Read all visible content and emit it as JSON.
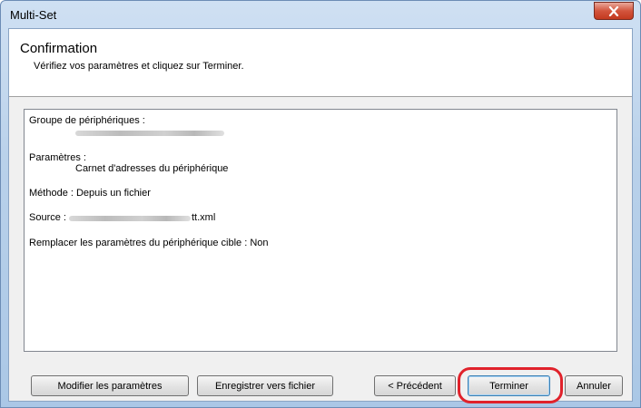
{
  "window": {
    "title": "Multi-Set",
    "close_icon": "close-icon"
  },
  "header": {
    "title": "Confirmation",
    "subtitle": "Vérifiez vos paramètres et cliquez sur Terminer."
  },
  "summary": {
    "group_label": "Groupe de périphériques :",
    "params_label": "Paramètres :",
    "params_value": "Carnet d'adresses du périphérique",
    "method": "Méthode : Depuis un fichier",
    "source_label": "Source :",
    "source_suffix": "tt.xml",
    "replace": "Remplacer les paramètres du périphérique cible : Non"
  },
  "buttons": {
    "modify": "Modifier les paramètres",
    "save": "Enregistrer vers fichier",
    "previous": "< Précédent",
    "finish": "Terminer",
    "cancel": "Annuler"
  },
  "colors": {
    "highlight": "#e0222b",
    "close_button": "#c3391f"
  }
}
